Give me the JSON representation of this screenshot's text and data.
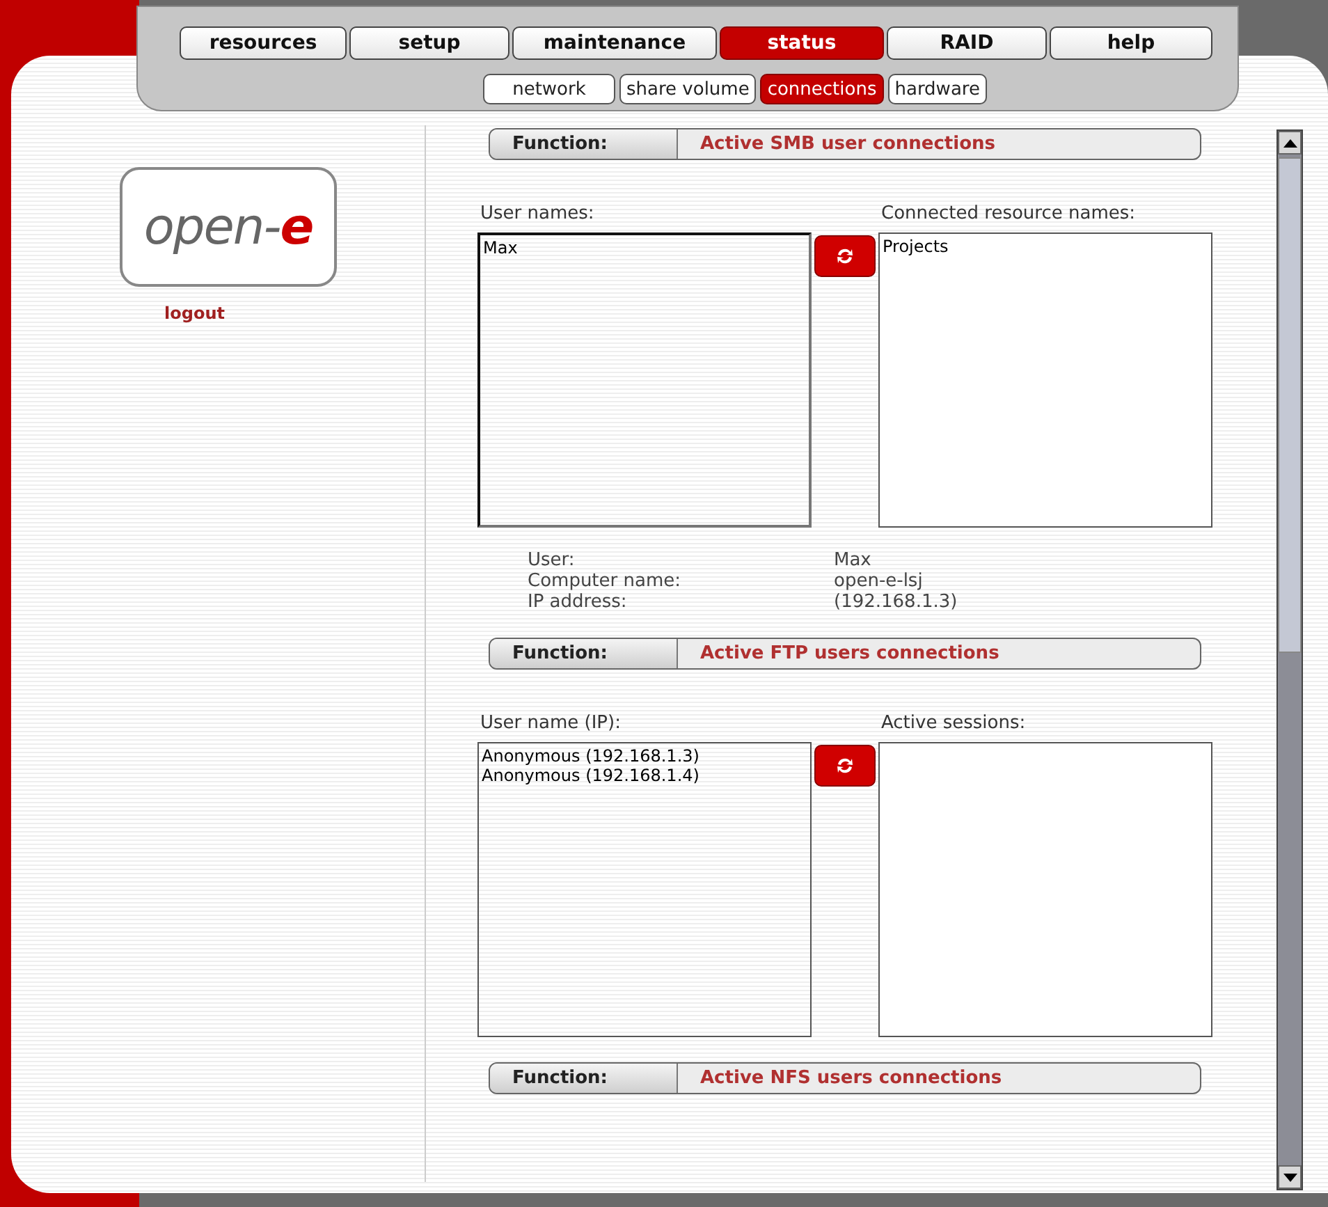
{
  "nav": {
    "tabs": [
      {
        "label": "resources",
        "selected": false
      },
      {
        "label": "setup",
        "selected": false
      },
      {
        "label": "maintenance",
        "selected": false
      },
      {
        "label": "status",
        "selected": true
      },
      {
        "label": "RAID",
        "selected": false
      },
      {
        "label": "help",
        "selected": false
      }
    ],
    "subtabs": [
      {
        "label": "network",
        "selected": false
      },
      {
        "label": "share volume",
        "selected": false
      },
      {
        "label": "connections",
        "selected": true
      },
      {
        "label": "hardware",
        "selected": false
      }
    ]
  },
  "logo": {
    "text": "open-",
    "accent": "e"
  },
  "logout": "logout",
  "sections": [
    {
      "function_label": "Function:",
      "title": "Active SMB user connections",
      "left": {
        "heading": "User names:",
        "items": [
          "Max"
        ],
        "focused": true
      },
      "right": {
        "heading": "Connected resource names:",
        "items": [
          "Projects"
        ],
        "focused": false
      },
      "details": [
        {
          "label": "User:",
          "value": "Max"
        },
        {
          "label": "Computer name:",
          "value": "open-e-lsj"
        },
        {
          "label": "IP address:",
          "value": "(192.168.1.3)"
        }
      ]
    },
    {
      "function_label": "Function:",
      "title": "Active FTP users connections",
      "left": {
        "heading": "User name (IP):",
        "items": [
          "Anonymous (192.168.1.3)",
          "Anonymous (192.168.1.4)"
        ],
        "focused": false
      },
      "right": {
        "heading": "Active sessions:",
        "focused": false
      }
    },
    {
      "function_label": "Function:",
      "title": "Active NFS users connections"
    }
  ]
}
